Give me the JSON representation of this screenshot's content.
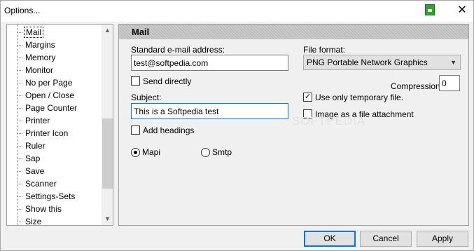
{
  "window": {
    "title": "Options...",
    "close_glyph": "✕"
  },
  "tree": {
    "items": [
      "Mail",
      "Margins",
      "Memory",
      "Monitor",
      "No per Page",
      "Open / Close",
      "Page Counter",
      "Printer",
      "Printer Icon",
      "Ruler",
      "Sap",
      "Save",
      "Scanner",
      "Settings-Sets",
      "Show this",
      "Size"
    ],
    "selected": "Mail",
    "scroll_up": "▲",
    "scroll_down": "▼"
  },
  "panel": {
    "title": "Mail",
    "email_label": "Standard e-mail address:",
    "email_value": "test@softpedia.com",
    "send_directly_label": "Send directly",
    "send_directly_checked": false,
    "subject_label": "Subject:",
    "subject_value": "This is a Softpedia test",
    "add_headings_label": "Add headings",
    "add_headings_checked": false,
    "mapi_label": "Mapi",
    "smtp_label": "Smtp",
    "selected_transport": "Mapi",
    "file_format_label": "File format:",
    "file_format_value": "PNG  Portable Network Graphics",
    "compression_label": "Compression:",
    "compression_value": "0",
    "temp_file_label": "Use only temporary file.",
    "temp_file_checked": true,
    "attachment_label": "Image as a file attachment",
    "attachment_checked": false,
    "watermark": "SOFTPEDIA"
  },
  "buttons": {
    "ok": "OK",
    "cancel": "Cancel",
    "apply": "Apply"
  }
}
